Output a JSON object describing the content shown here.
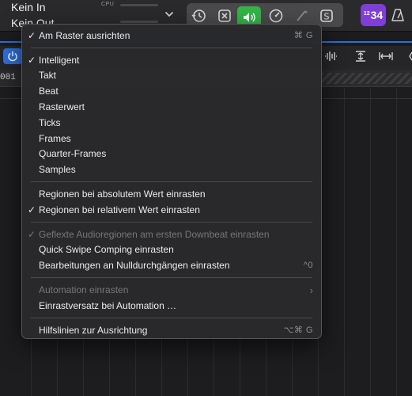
{
  "topbar": {
    "input_line1": "Kein In",
    "input_line2": "Kein Out",
    "cpu_label": "CPU",
    "counter_badge": {
      "superscript": "12",
      "text": "34"
    },
    "accent_green": "#34b548",
    "accent_purple": "#7f3fd6",
    "accent_blue": "#2f6fd6"
  },
  "ruler": {
    "position_text": "001"
  },
  "menu": {
    "groups": [
      [
        {
          "label": "Am Raster ausrichten",
          "checked": true,
          "enabled": true,
          "shortcut": "⌘ G"
        }
      ],
      [
        {
          "label": "Intelligent",
          "checked": true,
          "enabled": true,
          "shortcut": ""
        },
        {
          "label": "Takt",
          "checked": false,
          "enabled": true,
          "shortcut": ""
        },
        {
          "label": "Beat",
          "checked": false,
          "enabled": true,
          "shortcut": ""
        },
        {
          "label": "Rasterwert",
          "checked": false,
          "enabled": true,
          "shortcut": ""
        },
        {
          "label": "Ticks",
          "checked": false,
          "enabled": true,
          "shortcut": ""
        },
        {
          "label": "Frames",
          "checked": false,
          "enabled": true,
          "shortcut": ""
        },
        {
          "label": "Quarter-Frames",
          "checked": false,
          "enabled": true,
          "shortcut": ""
        },
        {
          "label": "Samples",
          "checked": false,
          "enabled": true,
          "shortcut": ""
        }
      ],
      [
        {
          "label": "Regionen bei absolutem Wert einrasten",
          "checked": false,
          "enabled": true,
          "shortcut": ""
        },
        {
          "label": "Regionen bei relativem Wert einrasten",
          "checked": true,
          "enabled": true,
          "shortcut": ""
        }
      ],
      [
        {
          "label": "Geflexte Audioregionen am ersten Downbeat einrasten",
          "checked": true,
          "enabled": false,
          "shortcut": ""
        },
        {
          "label": "Quick Swipe Comping einrasten",
          "checked": false,
          "enabled": true,
          "shortcut": ""
        },
        {
          "label": "Bearbeitungen an Nulldurchgängen einrasten",
          "checked": false,
          "enabled": true,
          "shortcut": "^0"
        }
      ],
      [
        {
          "label": "Automation einrasten",
          "checked": false,
          "enabled": false,
          "shortcut": "",
          "submenu": true
        },
        {
          "label": "Einrastversatz bei Automation …",
          "checked": false,
          "enabled": true,
          "shortcut": ""
        }
      ],
      [
        {
          "label": "Hilfslinien zur Ausrichtung",
          "checked": false,
          "enabled": true,
          "shortcut": "⌥⌘ G"
        }
      ]
    ],
    "check_glyph": "✓",
    "submenu_glyph": "›"
  }
}
